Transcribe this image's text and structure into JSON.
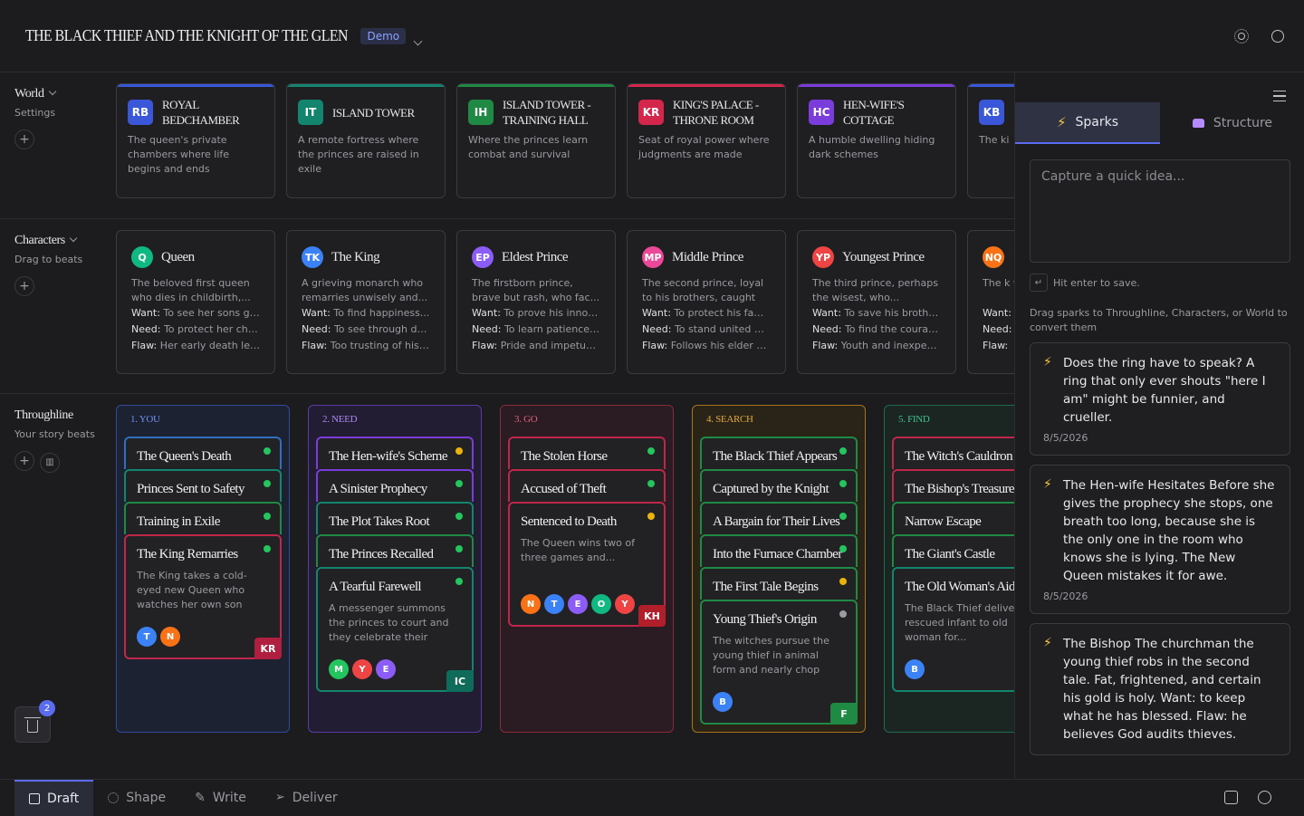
{
  "header": {
    "title": "THE BLACK THIEF AND THE KNIGHT OF THE GLEN",
    "badge": "Demo"
  },
  "rows": {
    "world": {
      "title": "World",
      "sub": "Settings"
    },
    "characters": {
      "title": "Characters",
      "sub": "Drag to beats"
    },
    "throughline": {
      "title": "Throughline",
      "sub": "Your story beats"
    }
  },
  "world_cards": [
    {
      "initials": "RB",
      "name": "ROYAL BEDCHAMBER",
      "desc": "The queen's private chambers where life begins and ends",
      "color": "#3b57d9"
    },
    {
      "initials": "IT",
      "name": "ISLAND TOWER",
      "desc": "A remote fortress where the princes are raised in exile",
      "color": "#13856f"
    },
    {
      "initials": "IH",
      "name": "ISLAND TOWER - TRAINING HALL",
      "desc": "Where the princes learn combat and survival",
      "color": "#1f8a44"
    },
    {
      "initials": "KR",
      "name": "KING'S PALACE - THRONE ROOM",
      "desc": "Seat of royal power where judgments are made",
      "color": "#d3264a"
    },
    {
      "initials": "HC",
      "name": "HEN-WIFE'S COTTAGE",
      "desc": "A humble dwelling hiding dark schemes",
      "color": "#7a3ddb"
    },
    {
      "initials": "KB",
      "name": "",
      "desc": "The ki",
      "color": "#3b57d9"
    }
  ],
  "character_cards": [
    {
      "initials": "Q",
      "name": "Queen",
      "desc": "The beloved first queen who dies in childbirth,...",
      "want": "To see her sons gr...",
      "need": "To protect her chi...",
      "flaw": "Her early death lea...",
      "color": "#10b981"
    },
    {
      "initials": "TK",
      "name": "The King",
      "desc": "A grieving monarch who remarries unwisely and...",
      "want": "To find happiness...",
      "need": "To see through de...",
      "flaw": "Too trusting of his ...",
      "color": "#3b82f6"
    },
    {
      "initials": "EP",
      "name": "Eldest Prince",
      "desc": "The firstborn prince, brave but rash, who fac...",
      "want": "To prove his innoc...",
      "need": "To learn patience ...",
      "flaw": "Pride and impetuo...",
      "color": "#8b5cf6"
    },
    {
      "initials": "MP",
      "name": "Middle Prince",
      "desc": "The second prince, loyal to his brothers, caught i...",
      "want": "To protect his fam...",
      "need": "To stand united w...",
      "flaw": "Follows his elder b...",
      "color": "#ec4899"
    },
    {
      "initials": "YP",
      "name": "Youngest Prince",
      "desc": "The third prince, perhaps the wisest, who...",
      "want": "To save his brothe...",
      "need": "To find the courag...",
      "flaw": "Youth and inexperi...",
      "color": "#ef4444"
    },
    {
      "initials": "NQ",
      "name": "",
      "desc": "The k who",
      "want": "",
      "need": "",
      "flaw": "",
      "color": "#f97316"
    }
  ],
  "labels": {
    "want": "Want:",
    "need": "Need:",
    "flaw": "Flaw:"
  },
  "acts": [
    {
      "label": "1. YOU",
      "border": "#2f4a9e",
      "bg": "#1d2233",
      "text": "#6f8ff0",
      "beats": [
        {
          "title": "The Queen's Death",
          "dot": "#22c55e",
          "color": "#2f6fc0"
        },
        {
          "title": "Princes Sent to Safety",
          "dot": "#22c55e",
          "color": "#13856f"
        },
        {
          "title": "Training in Exile",
          "dot": "#22c55e",
          "color": "#1f8a44"
        },
        {
          "title": "The King Remarries",
          "dot": "#22c55e",
          "color": "#c0264a",
          "desc": "The King takes a cold-eyed new Queen who watches her own son wit...",
          "avatars": [
            {
              "i": "T",
              "c": "#3b82f6"
            },
            {
              "i": "N",
              "c": "#f97316"
            }
          ],
          "corner": "KR",
          "cornerColor": "#b01f3f"
        }
      ]
    },
    {
      "label": "2. NEED",
      "border": "#5b3aa8",
      "bg": "#231d33",
      "text": "#a88af0",
      "beats": [
        {
          "title": "The Hen-wife's Scheme",
          "dot": "#eab308",
          "color": "#7a3ddb"
        },
        {
          "title": "A Sinister Prophecy",
          "dot": "#22c55e",
          "color": "#7a3ddb"
        },
        {
          "title": "The Plot Takes Root",
          "dot": "#22c55e",
          "color": "#13856f"
        },
        {
          "title": "The Princes Recalled",
          "dot": "#22c55e",
          "color": "#1f8a44"
        },
        {
          "title": "A Tearful Farewell",
          "dot": "#22c55e",
          "color": "#13856f",
          "desc": "A messenger summons the princes to court and they celebrate their long...",
          "avatars": [
            {
              "i": "M",
              "c": "#22c55e"
            },
            {
              "i": "Y",
              "c": "#ef4444"
            },
            {
              "i": "E",
              "c": "#8b5cf6"
            }
          ],
          "corner": "IC",
          "cornerColor": "#0f6b5a"
        }
      ]
    },
    {
      "label": "3. GO",
      "border": "#8a2a3a",
      "bg": "#2a1c22",
      "text": "#e0607a",
      "beats": [
        {
          "title": "The Stolen Horse",
          "dot": "#22c55e",
          "color": "#c0264a"
        },
        {
          "title": "Accused of Theft",
          "dot": "#22c55e",
          "color": "#c0264a"
        },
        {
          "title": "Sentenced to Death",
          "dot": "#eab308",
          "color": "#c0264a",
          "desc": "The Queen wins two of three games and...",
          "avatars": [
            {
              "i": "N",
              "c": "#f97316"
            },
            {
              "i": "T",
              "c": "#3b82f6"
            },
            {
              "i": "E",
              "c": "#8b5cf6"
            },
            {
              "i": "O",
              "c": "#10b981"
            },
            {
              "i": "Y",
              "c": "#ef4444"
            }
          ],
          "corner": "KH",
          "cornerColor": "#b01f2a"
        }
      ]
    },
    {
      "label": "4. SEARCH",
      "border": "#a8741a",
      "bg": "#2a2418",
      "text": "#e0a840",
      "beats": [
        {
          "title": "The Black Thief Appears",
          "dot": "#22c55e",
          "color": "#1f8a44"
        },
        {
          "title": "Captured by the Knight",
          "dot": "#22c55e",
          "color": "#1f8a44"
        },
        {
          "title": "A Bargain for Their Lives",
          "dot": "#22c55e",
          "color": "#1f8a44"
        },
        {
          "title": "Into the Furnace Chamber",
          "dot": "#22c55e",
          "color": "#1f8a44"
        },
        {
          "title": "The First Tale Begins",
          "dot": "#eab308",
          "color": "#1f8a44"
        },
        {
          "title": "Young Thief's Origin",
          "dot": "#9a9aa0",
          "color": "#1f8a44",
          "desc": "The witches pursue the young thief in animal form and nearly chop down hi...",
          "avatars": [
            {
              "i": "B",
              "c": "#3b82f6"
            }
          ],
          "corner": "F",
          "cornerColor": "#1f8a44"
        }
      ]
    },
    {
      "label": "5. FIND",
      "border": "#1f6b50",
      "bg": "#1b2622",
      "text": "#40c090",
      "beats": [
        {
          "title": "The Witch's Cauldron",
          "dot": "",
          "color": "#c0264a"
        },
        {
          "title": "The Bishop's Treasure",
          "dot": "",
          "color": "#c0264a"
        },
        {
          "title": "Narrow Escape",
          "dot": "",
          "color": "#1f8a44"
        },
        {
          "title": "The Giant's Castle",
          "dot": "",
          "color": "#1f8a44"
        },
        {
          "title": "The Old Woman's Aid",
          "dot": "",
          "color": "#13856f",
          "desc": "The Black Thief delive the rescued infant to old woman for...",
          "avatars": [
            {
              "i": "B",
              "c": "#3b82f6"
            }
          ],
          "corner": "",
          "cornerColor": ""
        }
      ]
    }
  ],
  "trash": {
    "count": "2"
  },
  "panel": {
    "tabs": [
      {
        "label": "Sparks"
      },
      {
        "label": "Structure"
      }
    ],
    "placeholder": "Capture a quick idea...",
    "hint": "Hit enter to save.",
    "note": "Drag sparks to Throughline, Characters, or World to convert them",
    "sparks": [
      {
        "text": "Does the ring have to speak? A ring that only ever shouts \"here I am\" might be funnier, and crueller.",
        "date": "8/5/2026"
      },
      {
        "text": "The Hen-wife Hesitates Before she gives the prophecy she stops, one breath too long, because she is the only one in the room who knows she is lying. The New Queen mistakes it for awe.",
        "date": "8/5/2026"
      },
      {
        "text": "The Bishop The churchman the young thief robs in the second tale. Fat, frightened, and certain his gold is holy. Want: to keep what he has blessed. Flaw: he believes God audits thieves.",
        "date": ""
      }
    ]
  },
  "bottom": {
    "tabs": [
      {
        "label": "Draft"
      },
      {
        "label": "Shape"
      },
      {
        "label": "Write"
      },
      {
        "label": "Deliver"
      }
    ]
  }
}
